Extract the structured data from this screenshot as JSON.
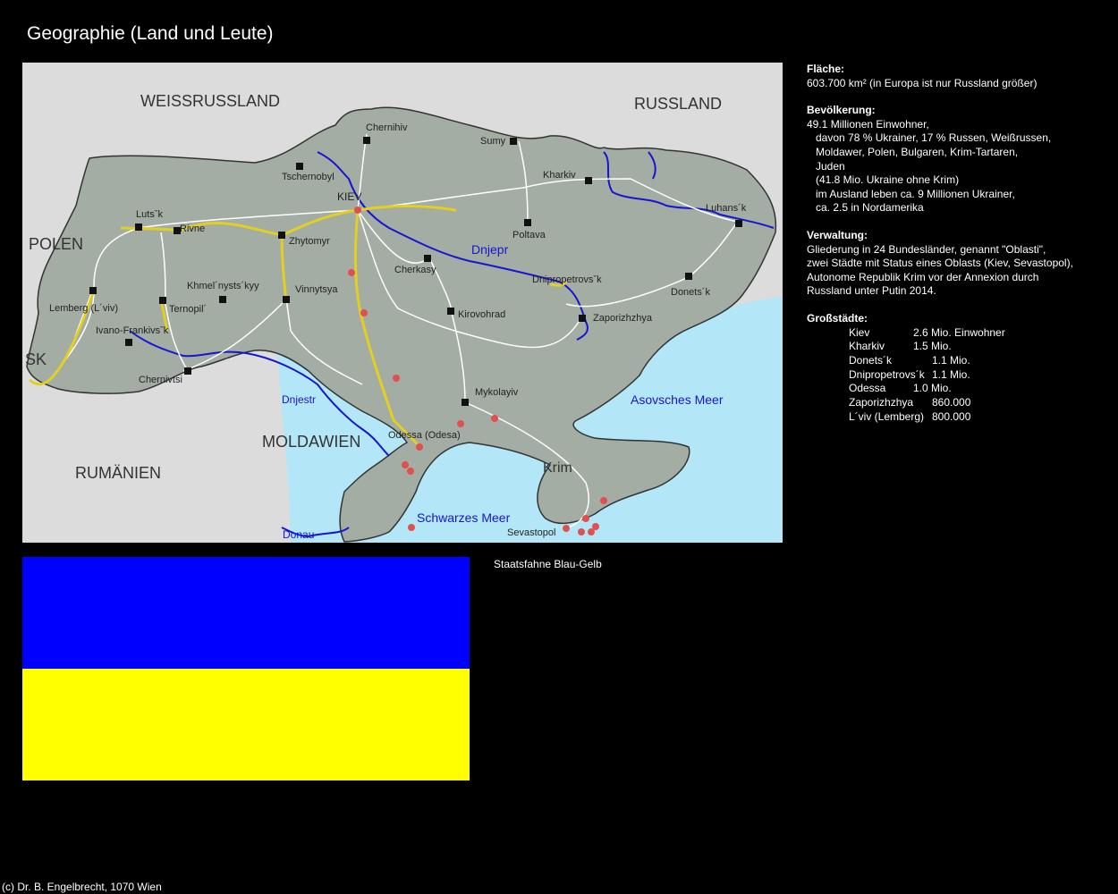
{
  "page_title": "Geographie (Land und Leute)",
  "map": {
    "colors": {
      "land": "#a3ada4",
      "neighbor": "#dcdcdc",
      "sea": "#b3e7f7",
      "river": "#1515d2",
      "road": "#ffffff",
      "highway": "#e2cf22",
      "border": "#333333"
    },
    "countries": [
      "WEISSRUSSLAND",
      "RUSSLAND",
      "POLEN",
      "SK",
      "MOLDAWIEN",
      "RUMÄNIEN"
    ],
    "water": [
      "Dnjepr",
      "Dnjestr",
      "Donau",
      "Asovsches Meer",
      "Schwarzes Meer"
    ],
    "region": "Krim",
    "cities": [
      "Chernihiv",
      "Sumy",
      "Tschernobyl",
      "KIEV",
      "Kharkiv",
      "Luhans´k",
      "Lutsˇk",
      "Rivne",
      "Zhytomyr",
      "Poltava",
      "Cherkasy",
      "Dnipropetrovsˇk",
      "Donets´k",
      "Khmel´nysts´kyy",
      "Vinnytsya",
      "Ternopil´",
      "Lemberg (L´viv)",
      "Kirovohrad",
      "Zaporizhzhya",
      "Ivano-Frankivsˇk",
      "Chernivtsi",
      "Mykolayiv",
      "Odessa (Odesa)",
      "Sevastopol"
    ]
  },
  "info": {
    "area": {
      "heading": "Fläche:",
      "text": "603.700 km² (in Europa ist nur Russland größer)"
    },
    "population": {
      "heading": "Bevölkerung:",
      "lines": [
        "49.1 Millionen Einwohner,",
        "davon 78 % Ukrainer, 17 % Russen, Weißrussen,",
        "Moldawer, Polen, Bulgaren, Krim-Tartaren,",
        "Juden",
        "(41.8 Mio. Ukraine ohne Krim)",
        "im Ausland leben ca. 9 Millionen Ukrainer,",
        "ca. 2.5 in Nordamerika"
      ]
    },
    "administration": {
      "heading": "Verwaltung:",
      "lines": [
        "Gliederung in 24 Bundesländer, genannt \"Oblasti\",",
        "zwei Städte mit Status eines Oblasts (Kiev, Sevastopol),",
        "Autonome Republik Krim vor der Annexion durch",
        "Russland unter Putin 2014."
      ]
    },
    "big_cities": {
      "heading": "Großstädte:",
      "rows": [
        {
          "name": "Kiev",
          "value": "2.6 Mio. Einwohner"
        },
        {
          "name": "Kharkiv",
          "value": "1.5 Mio."
        },
        {
          "name": "Donets´k",
          "value": "1.1 Mio."
        },
        {
          "name": "Dnipropetrovs´k",
          "value": "1.1 Mio."
        },
        {
          "name": "Odessa",
          "value": "1.0 Mio."
        },
        {
          "name": "Zaporizhzhya",
          "value": "860.000"
        },
        {
          "name": "L´viv (Lemberg)",
          "value": "800.000"
        }
      ]
    }
  },
  "flag": {
    "caption": "Staatsfahne Blau-Gelb",
    "top_color": "#0000ff",
    "bottom_color": "#ffff00"
  },
  "footer": "(c) Dr. B. Engelbrecht, 1070 Wien"
}
